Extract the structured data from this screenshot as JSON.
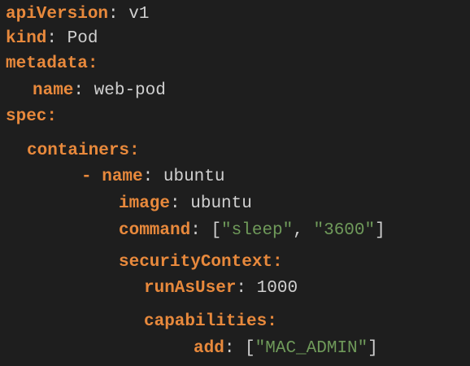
{
  "colors": {
    "background": "#1e1e1e",
    "key": "#e8893c",
    "value": "#d0d0d0",
    "string": "#6f9a5a"
  },
  "code": {
    "l1": {
      "key": "apiVersion",
      "sep": ": ",
      "value": "v1"
    },
    "l2": {
      "key": "kind",
      "sep": ": ",
      "value": "Pod"
    },
    "l3": {
      "key": "metadata",
      "sep": ":"
    },
    "l4": {
      "key": "name",
      "sep": ": ",
      "value": "web-pod"
    },
    "l5": {
      "key": "spec",
      "sep": ":"
    },
    "l6": {
      "key": "containers",
      "sep": ":"
    },
    "l7": {
      "dash": "- ",
      "key": "name",
      "sep": ": ",
      "value": "ubuntu"
    },
    "l8": {
      "key": "image",
      "sep": ": ",
      "value": "ubuntu"
    },
    "l9": {
      "key": "command",
      "sep": ": ",
      "open": "[",
      "s1": "\"sleep\"",
      "comma": ", ",
      "s2": "\"3600\"",
      "close": "]"
    },
    "l10": {
      "key": "securityContext",
      "sep": ":"
    },
    "l11": {
      "key": "runAsUser",
      "sep": ": ",
      "value": "1000"
    },
    "l12": {
      "key": "capabilities",
      "sep": ":"
    },
    "l13": {
      "key": "add",
      "sep": ": ",
      "open": "[",
      "s1": "\"MAC_ADMIN\"",
      "close": "]"
    }
  }
}
